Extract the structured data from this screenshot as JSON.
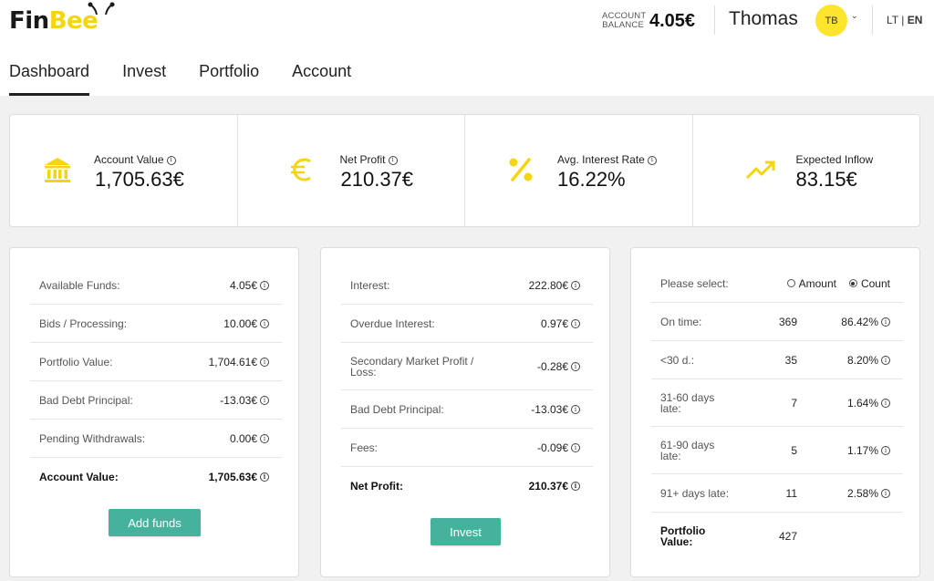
{
  "brand": {
    "part1": "Fin",
    "part2": "Bee",
    "accent": "#f5d410"
  },
  "header": {
    "balance_label": "ACCOUNT\nBALANCE",
    "balance_value": "4.05€",
    "user_name": "Thomas",
    "avatar_initials": "TB",
    "lang_lt": "LT",
    "lang_sep": " | ",
    "lang_en": "EN"
  },
  "nav": {
    "tabs": [
      {
        "label": "Dashboard",
        "active": true
      },
      {
        "label": "Invest"
      },
      {
        "label": "Portfolio"
      },
      {
        "label": "Account"
      }
    ]
  },
  "stats": [
    {
      "icon": "bank-icon",
      "label": "Account Value",
      "value": "1,705.63€"
    },
    {
      "icon": "euro-icon",
      "label": "Net Profit",
      "value": "210.37€"
    },
    {
      "icon": "percent-icon",
      "label": "Avg. Interest Rate",
      "value": "16.22%"
    },
    {
      "icon": "trend-up-icon",
      "label": "Expected Inflow",
      "value": "83.15€"
    }
  ],
  "account_panel": {
    "rows": [
      {
        "label": "Available Funds:",
        "value": "4.05€"
      },
      {
        "label": "Bids / Processing:",
        "value": "10.00€"
      },
      {
        "label": "Portfolio Value:",
        "value": "1,704.61€"
      },
      {
        "label": "Bad Debt Principal:",
        "value": "-13.03€"
      },
      {
        "label": "Pending Withdrawals:",
        "value": "0.00€"
      },
      {
        "label": "Account Value:",
        "value": "1,705.63€"
      }
    ],
    "button": "Add funds"
  },
  "profit_panel": {
    "rows": [
      {
        "label": "Interest:",
        "value": "222.80€"
      },
      {
        "label": "Overdue Interest:",
        "value": "0.97€"
      },
      {
        "label": "Secondary Market Profit / Loss:",
        "value": "-0.28€"
      },
      {
        "label": "Bad Debt Principal:",
        "value": "-13.03€"
      },
      {
        "label": "Fees:",
        "value": "-0.09€"
      },
      {
        "label": "Net Profit:",
        "value": "210.37€"
      }
    ],
    "button": "Invest"
  },
  "portfolio_panel": {
    "select_label": "Please select:",
    "options": [
      {
        "label": "Amount",
        "selected": false
      },
      {
        "label": "Count",
        "selected": true
      }
    ],
    "rows": [
      {
        "label": "On time:",
        "count": "369",
        "percent": "86.42%"
      },
      {
        "label": "<30 d.:",
        "count": "35",
        "percent": "8.20%"
      },
      {
        "label": "31-60 days late:",
        "count": "7",
        "percent": "1.64%"
      },
      {
        "label": "61-90 days late:",
        "count": "5",
        "percent": "1.17%"
      },
      {
        "label": "91+ days late:",
        "count": "11",
        "percent": "2.58%"
      }
    ],
    "total_label": "Portfolio Value:",
    "total_count": "427"
  },
  "colors": {
    "button": "#45b39b",
    "avatar": "#fde52d",
    "icon": "#f5d410"
  }
}
